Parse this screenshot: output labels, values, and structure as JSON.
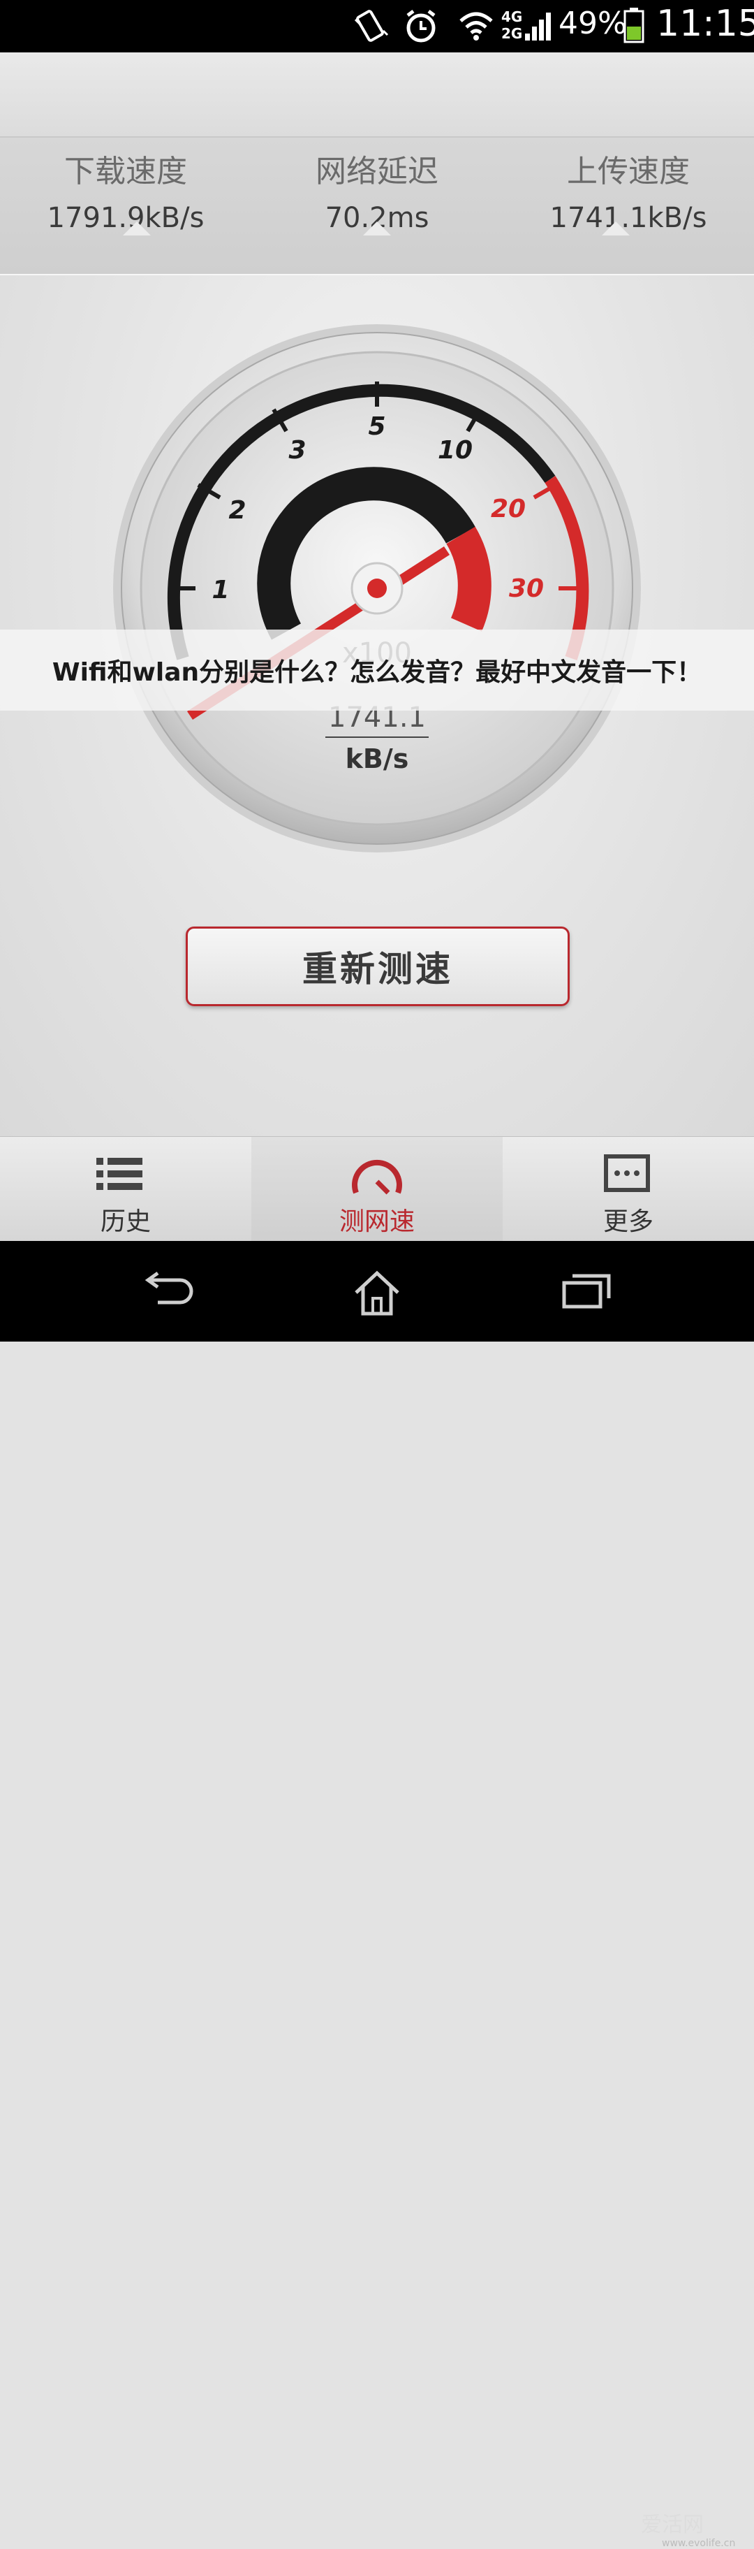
{
  "status_bar": {
    "network": "4G\n2G",
    "network_top": "4G",
    "network_bottom": "2G",
    "battery": "49%",
    "time": "11:15"
  },
  "stats": [
    {
      "label": "下载速度",
      "value": "1791.9kB/s"
    },
    {
      "label": "网络延迟",
      "value": "70.2ms"
    },
    {
      "label": "上传速度",
      "value": "1741.1kB/s"
    }
  ],
  "gauge": {
    "scale_labels": [
      "1",
      "2",
      "3",
      "5",
      "10",
      "20",
      "30"
    ],
    "multiplier": "x100",
    "value": "1741.1",
    "unit": "kB/s",
    "colors": {
      "accent": "#d42a2a",
      "dial": "#1a1a1a"
    }
  },
  "retest_button": {
    "label": "重新测速"
  },
  "caption": {
    "text": "Wifi和wlan分别是什么？怎么发音？最好中文发音一下！"
  },
  "tabs": [
    {
      "label": "历史",
      "icon": "list-icon"
    },
    {
      "label": "测网速",
      "icon": "speedometer-icon"
    },
    {
      "label": "更多",
      "icon": "more-icon"
    }
  ],
  "watermark": {
    "text": "爱活网",
    "sub": "www.evolife.cn"
  }
}
